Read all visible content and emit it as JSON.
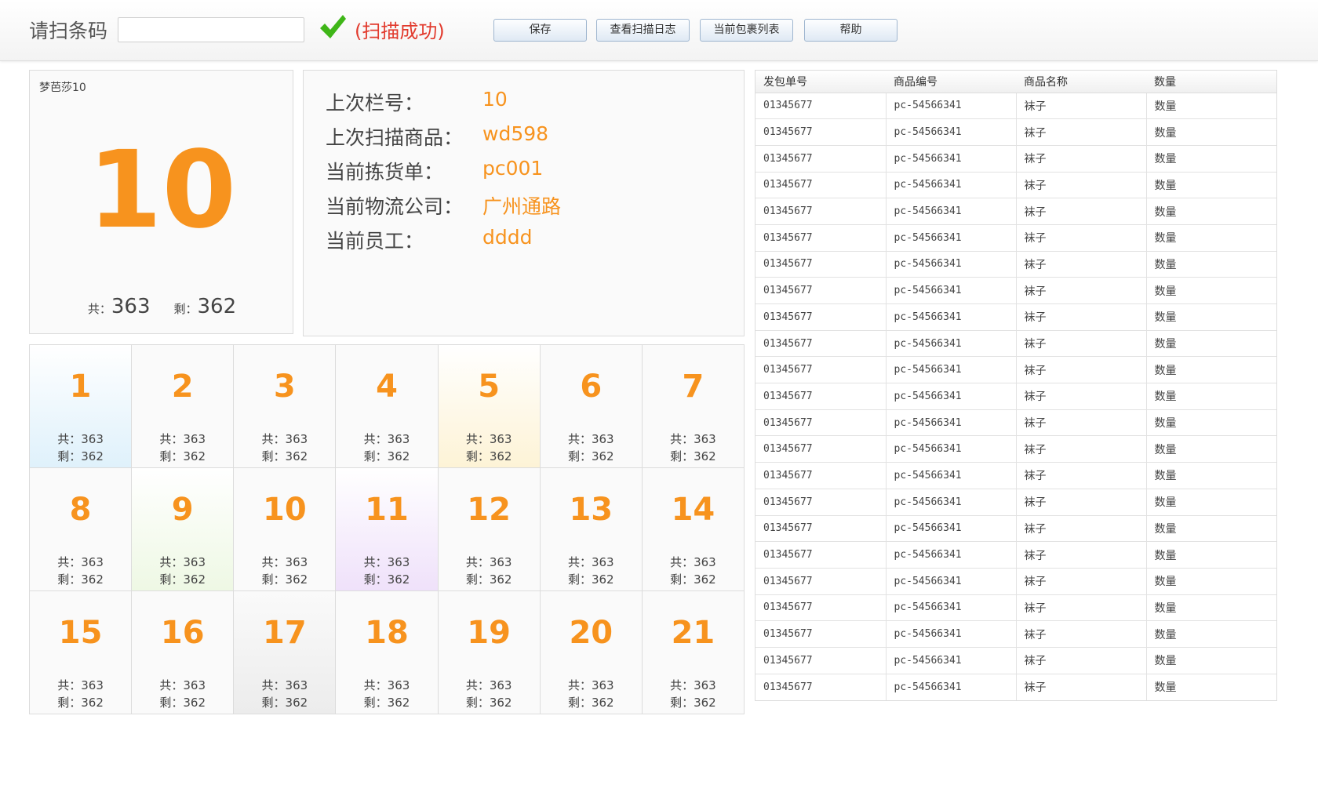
{
  "topbar": {
    "scan_label": "请扫条码",
    "scan_input_value": "",
    "status_text": "(扫描成功)",
    "status_icon": "checkmark-icon",
    "buttons": {
      "save": "保存",
      "log": "查看扫描日志",
      "list": "当前包裹列表",
      "help": "帮助"
    }
  },
  "slot": {
    "name": "梦芭莎10",
    "number": "10",
    "total_label": "共：",
    "total": "363",
    "remain_label": "剩：",
    "remain": "362"
  },
  "info": [
    {
      "label": "上次栏号：",
      "value": "10"
    },
    {
      "label": "上次扫描商品：",
      "value": "wd598"
    },
    {
      "label": "当前拣货单：",
      "value": "pc001"
    },
    {
      "label": "当前物流公司：",
      "value": "广州通路"
    },
    {
      "label": "当前员工：",
      "value": "dddd"
    }
  ],
  "grid": [
    {
      "num": "1",
      "total": "共：363",
      "remain": "剩：362",
      "tint": "blue"
    },
    {
      "num": "2",
      "total": "共：363",
      "remain": "剩：362",
      "tint": ""
    },
    {
      "num": "3",
      "total": "共：363",
      "remain": "剩：362",
      "tint": ""
    },
    {
      "num": "4",
      "total": "共：363",
      "remain": "剩：362",
      "tint": ""
    },
    {
      "num": "5",
      "total": "共：363",
      "remain": "剩：362",
      "tint": "yellow"
    },
    {
      "num": "6",
      "total": "共：363",
      "remain": "剩：362",
      "tint": ""
    },
    {
      "num": "7",
      "total": "共：363",
      "remain": "剩：362",
      "tint": ""
    },
    {
      "num": "8",
      "total": "共：363",
      "remain": "剩：362",
      "tint": ""
    },
    {
      "num": "9",
      "total": "共：363",
      "remain": "剩：362",
      "tint": "green"
    },
    {
      "num": "10",
      "total": "共：363",
      "remain": "剩：362",
      "tint": ""
    },
    {
      "num": "11",
      "total": "共：363",
      "remain": "剩：362",
      "tint": "purple"
    },
    {
      "num": "12",
      "total": "共：363",
      "remain": "剩：362",
      "tint": ""
    },
    {
      "num": "13",
      "total": "共：363",
      "remain": "剩：362",
      "tint": ""
    },
    {
      "num": "14",
      "total": "共：363",
      "remain": "剩：362",
      "tint": ""
    },
    {
      "num": "15",
      "total": "共：363",
      "remain": "剩：362",
      "tint": ""
    },
    {
      "num": "16",
      "total": "共：363",
      "remain": "剩：362",
      "tint": ""
    },
    {
      "num": "17",
      "total": "共：363",
      "remain": "剩：362",
      "tint": "gray"
    },
    {
      "num": "18",
      "total": "共：363",
      "remain": "剩：362",
      "tint": ""
    },
    {
      "num": "19",
      "total": "共：363",
      "remain": "剩：362",
      "tint": ""
    },
    {
      "num": "20",
      "total": "共：363",
      "remain": "剩：362",
      "tint": ""
    },
    {
      "num": "21",
      "total": "共：363",
      "remain": "剩：362",
      "tint": ""
    }
  ],
  "table": {
    "headers": [
      "发包单号",
      "商品编号",
      "商品名称",
      "数量"
    ],
    "rows": [
      [
        "01345677",
        "pc-54566341",
        "袜子",
        "数量"
      ],
      [
        "01345677",
        "pc-54566341",
        "袜子",
        "数量"
      ],
      [
        "01345677",
        "pc-54566341",
        "袜子",
        "数量"
      ],
      [
        "01345677",
        "pc-54566341",
        "袜子",
        "数量"
      ],
      [
        "01345677",
        "pc-54566341",
        "袜子",
        "数量"
      ],
      [
        "01345677",
        "pc-54566341",
        "袜子",
        "数量"
      ],
      [
        "01345677",
        "pc-54566341",
        "袜子",
        "数量"
      ],
      [
        "01345677",
        "pc-54566341",
        "袜子",
        "数量"
      ],
      [
        "01345677",
        "pc-54566341",
        "袜子",
        "数量"
      ],
      [
        "01345677",
        "pc-54566341",
        "袜子",
        "数量"
      ],
      [
        "01345677",
        "pc-54566341",
        "袜子",
        "数量"
      ],
      [
        "01345677",
        "pc-54566341",
        "袜子",
        "数量"
      ],
      [
        "01345677",
        "pc-54566341",
        "袜子",
        "数量"
      ],
      [
        "01345677",
        "pc-54566341",
        "袜子",
        "数量"
      ],
      [
        "01345677",
        "pc-54566341",
        "袜子",
        "数量"
      ],
      [
        "01345677",
        "pc-54566341",
        "袜子",
        "数量"
      ],
      [
        "01345677",
        "pc-54566341",
        "袜子",
        "数量"
      ],
      [
        "01345677",
        "pc-54566341",
        "袜子",
        "数量"
      ],
      [
        "01345677",
        "pc-54566341",
        "袜子",
        "数量"
      ],
      [
        "01345677",
        "pc-54566341",
        "袜子",
        "数量"
      ],
      [
        "01345677",
        "pc-54566341",
        "袜子",
        "数量"
      ],
      [
        "01345677",
        "pc-54566341",
        "袜子",
        "数量"
      ],
      [
        "01345677",
        "pc-54566341",
        "袜子",
        "数量"
      ]
    ]
  },
  "colors": {
    "accent": "#f7931e",
    "status": "#e23b2e",
    "check": "#3fb618"
  }
}
